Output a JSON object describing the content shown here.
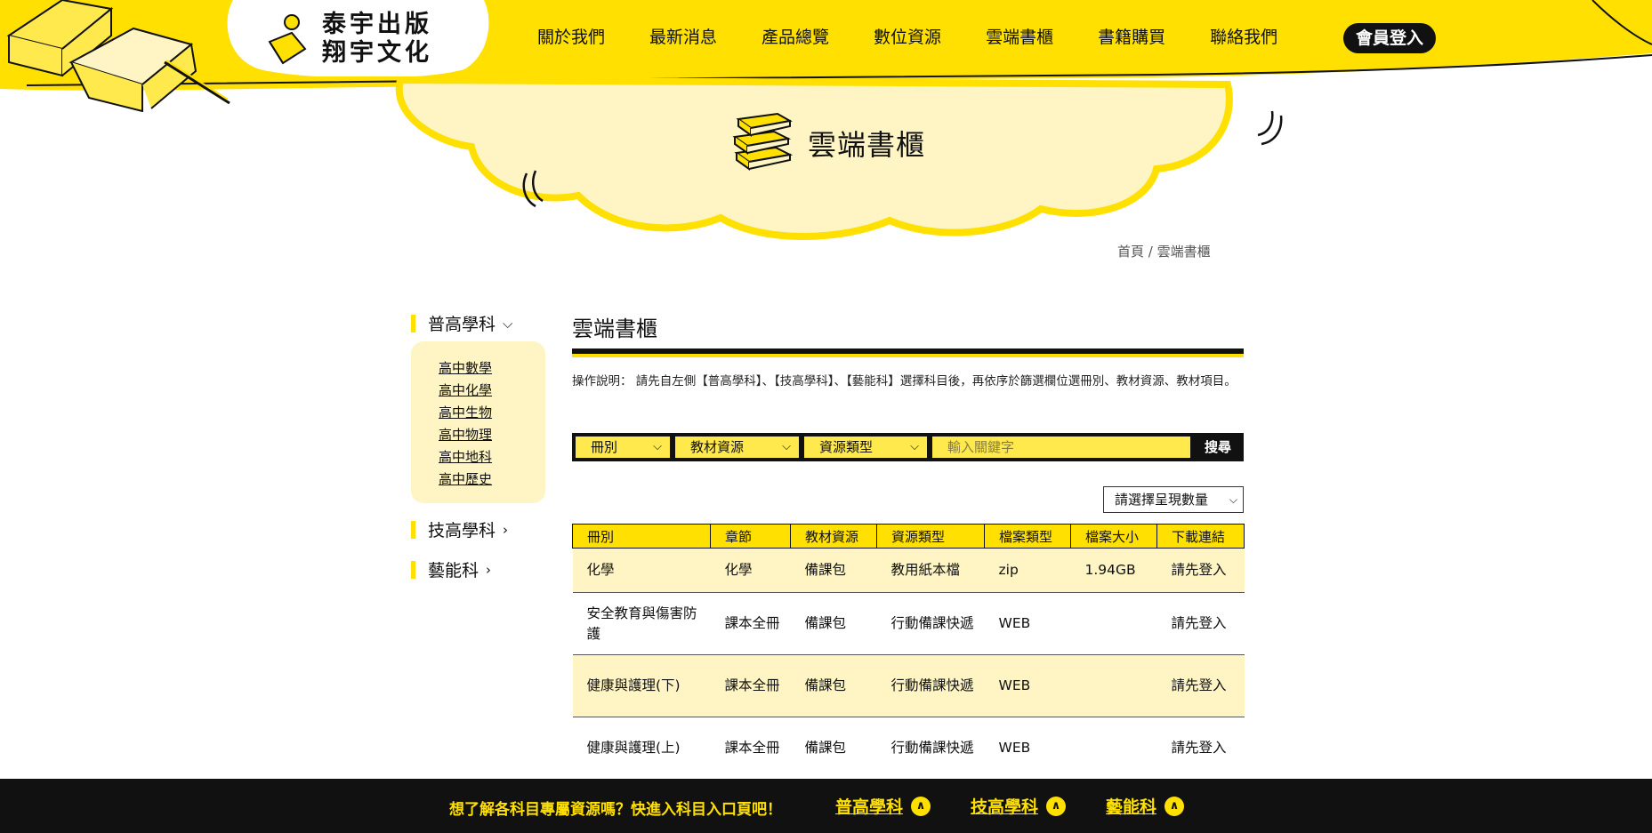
{
  "brand": {
    "line1": "泰宇出版",
    "line2": "翔宇文化",
    "accent_color": "#ffe000",
    "dark_color": "#111111"
  },
  "nav": {
    "items": [
      {
        "label": "關於我們"
      },
      {
        "label": "最新消息"
      },
      {
        "label": "產品總覽"
      },
      {
        "label": "數位資源"
      },
      {
        "label": "雲端書櫃",
        "active": true
      },
      {
        "label": "書籍購買"
      },
      {
        "label": "聯絡我們"
      }
    ],
    "login_label": "會員登入"
  },
  "banner": {
    "title": "雲端書櫃",
    "icon": "books-stack-icon"
  },
  "breadcrumb": {
    "home": "首頁",
    "sep": " / ",
    "current": "雲端書櫃"
  },
  "sidebar": {
    "categories": [
      {
        "label": "普高學科",
        "icon": "chevron-down-icon"
      },
      {
        "label": "技高學科",
        "icon": "chevron-right-icon"
      },
      {
        "label": "藝能科",
        "icon": "chevron-right-icon"
      }
    ],
    "subjects": [
      "高中數學",
      "高中化學",
      "高中生物",
      "高中物理",
      "高中地科",
      "高中歷史"
    ]
  },
  "main": {
    "title": "雲端書櫃",
    "instructions": "操作說明： 請先自左側【普高學科】、【技高學科】、【藝能科】選擇科目後，再依序於篩選欄位選冊別、教材資源、教材項目。"
  },
  "filters": {
    "volume": "冊別",
    "material": "教材資源",
    "resource_type": "資源類型",
    "keyword_placeholder": "輸入關鍵字",
    "search_label": "搜尋",
    "count_select": "請選擇呈現數量"
  },
  "table": {
    "headers": [
      "冊別",
      "章節",
      "教材資源",
      "資源類型",
      "檔案類型",
      "檔案大小",
      "下載連結"
    ],
    "rows": [
      [
        "化學",
        "化學",
        "備課包",
        "教用紙本檔",
        "zip",
        "1.94GB",
        "請先登入"
      ],
      [
        "安全教育與傷害防護",
        "課本全冊",
        "備課包",
        "行動備課快遞",
        "WEB",
        "",
        "請先登入"
      ],
      [
        "健康與護理(下)",
        "課本全冊",
        "備課包",
        "行動備課快遞",
        "WEB",
        "",
        "請先登入"
      ],
      [
        "健康與護理(上)",
        "課本全冊",
        "備課包",
        "行動備課快遞",
        "WEB",
        "",
        "請先登入"
      ]
    ]
  },
  "footer": {
    "prompt": "想了解各科目專屬資源嗎？快進入科目入口頁吧！",
    "links": [
      "普高學科",
      "技高學科",
      "藝能科"
    ]
  }
}
